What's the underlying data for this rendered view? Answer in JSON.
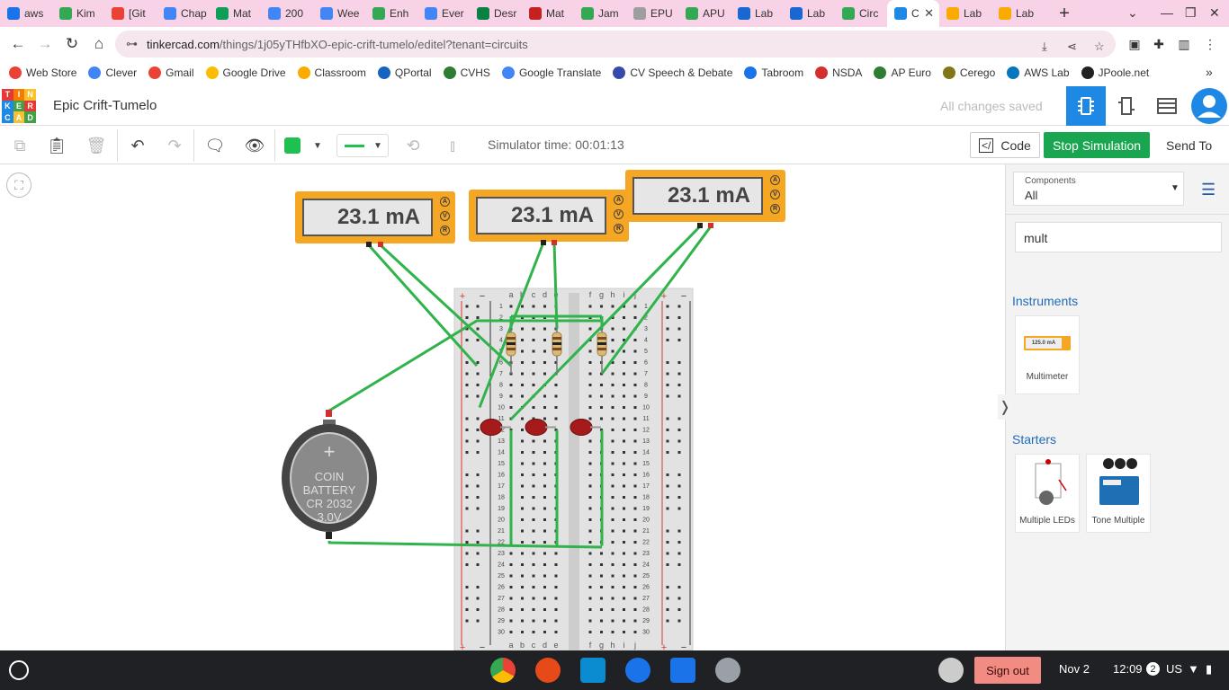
{
  "browser": {
    "tabs": [
      {
        "label": "aws",
        "color": "#1a73e8"
      },
      {
        "label": "Kim",
        "color": "#34a853"
      },
      {
        "label": "[Git",
        "color": "#ea4335"
      },
      {
        "label": "Chap",
        "color": "#4285f4"
      },
      {
        "label": "Mat",
        "color": "#0f9d58"
      },
      {
        "label": "200",
        "color": "#4285f4"
      },
      {
        "label": "Wee",
        "color": "#4285f4"
      },
      {
        "label": "Enh",
        "color": "#34a853"
      },
      {
        "label": "Ever",
        "color": "#4285f4"
      },
      {
        "label": "Desr",
        "color": "#0b8043"
      },
      {
        "label": "Mat",
        "color": "#c5221f"
      },
      {
        "label": "Jam",
        "color": "#34a853"
      },
      {
        "label": "EPU",
        "color": "#9e9e9e"
      },
      {
        "label": "APU",
        "color": "#34a853"
      },
      {
        "label": "Lab",
        "color": "#1967d2"
      },
      {
        "label": "Lab",
        "color": "#1967d2"
      },
      {
        "label": "Circ",
        "color": "#34a853"
      },
      {
        "label": "C",
        "color": "#1e88e5"
      },
      {
        "label": "Lab",
        "color": "#f9ab00"
      },
      {
        "label": "Lab",
        "color": "#f9ab00"
      }
    ],
    "new_tab_label": "+",
    "url_host": "tinkercad.com",
    "url_path": "/things/1j05yTHfbXO-epic-crift-tumelo/editel?tenant=circuits",
    "bookmarks": [
      {
        "label": "Web Store",
        "color": "#e94235"
      },
      {
        "label": "Clever",
        "color": "#4285f4"
      },
      {
        "label": "Gmail",
        "color": "#ea4335"
      },
      {
        "label": "Google Drive",
        "color": "#fbbc04"
      },
      {
        "label": "Classroom",
        "color": "#f9ab00"
      },
      {
        "label": "QPortal",
        "color": "#1565c0"
      },
      {
        "label": "CVHS",
        "color": "#2e7d32"
      },
      {
        "label": "Google Translate",
        "color": "#4285f4"
      },
      {
        "label": "CV Speech & Debate",
        "color": "#3949ab"
      },
      {
        "label": "Tabroom",
        "color": "#1a73e8"
      },
      {
        "label": "NSDA",
        "color": "#d32f2f"
      },
      {
        "label": "AP Euro",
        "color": "#2e7d32"
      },
      {
        "label": "Cerego",
        "color": "#827717"
      },
      {
        "label": "AWS Lab",
        "color": "#0277bd"
      },
      {
        "label": "JPoole.net",
        "color": "#212121"
      }
    ],
    "bookmarks_more": "»"
  },
  "tinkercad": {
    "logo_letters": [
      "T",
      "I",
      "N",
      "K",
      "E",
      "R",
      "C",
      "A",
      "D"
    ],
    "project_title": "Epic Crift-Tumelo",
    "save_status": "All changes saved",
    "simulator_time": "Simulator time: 00:01:13",
    "code_label": "Code",
    "stop_label": "Stop Simulation",
    "send_label": "Send To"
  },
  "circuit": {
    "meters": [
      {
        "reading": "23.1 mA"
      },
      {
        "reading": "23.1 mA"
      },
      {
        "reading": "23.1 mA"
      }
    ],
    "meter_modes": [
      "A",
      "V",
      "R"
    ],
    "battery": {
      "line1": "COIN BATTERY",
      "line2": "CR 2032",
      "line3": "3.0V",
      "plus": "+"
    },
    "breadboard": {
      "cols_left": [
        "a",
        "b",
        "c",
        "d",
        "e"
      ],
      "cols_right": [
        "f",
        "g",
        "h",
        "i",
        "j"
      ],
      "rows": 30,
      "rail_plus": "+",
      "rail_minus": "−"
    }
  },
  "panel": {
    "components_label": "Components",
    "components_value": "All",
    "search_value": "mult",
    "instruments_title": "Instruments",
    "instruments": [
      {
        "label": "Multimeter",
        "thumb_text": "125.0 mA"
      }
    ],
    "starters_title": "Starters",
    "starters": [
      {
        "label": "Multiple LEDs"
      },
      {
        "label": "Tone Multiple"
      }
    ],
    "collapse_glyph": "❭"
  },
  "taskbar": {
    "sign_out": "Sign out",
    "date": "Nov 2",
    "time": "12:09",
    "notif_count": "2",
    "locale": "US"
  }
}
